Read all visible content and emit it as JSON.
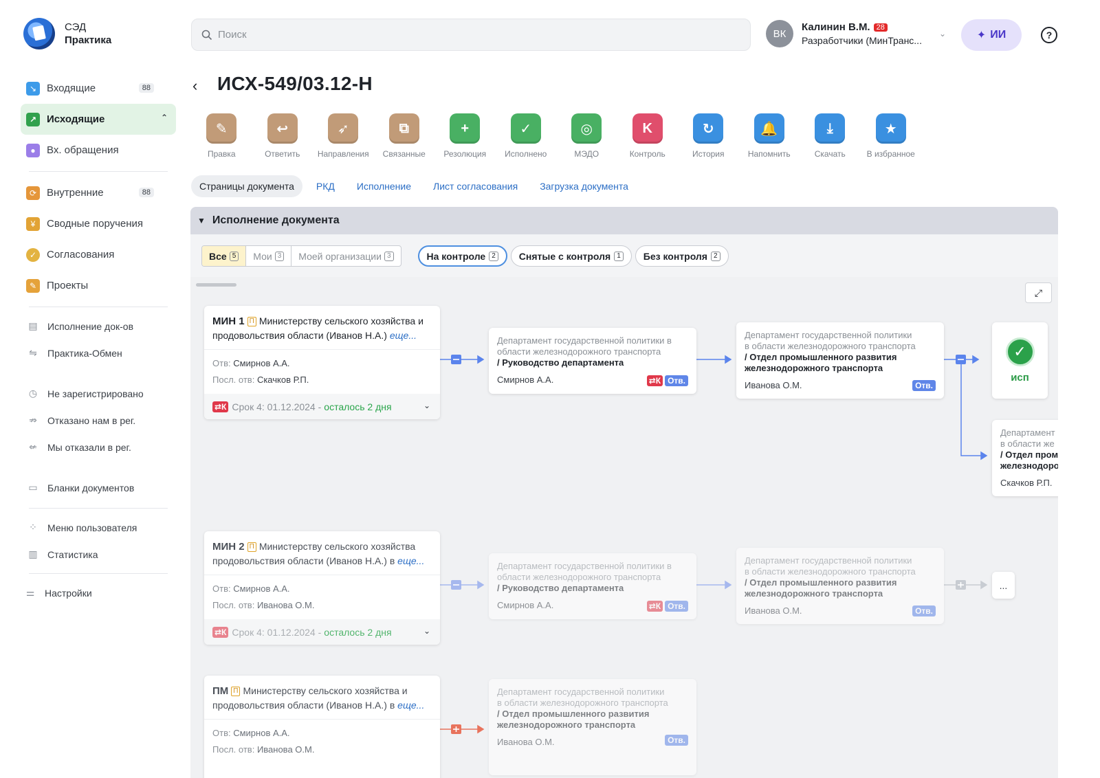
{
  "app": {
    "title_line1": "СЭД",
    "title_line2": "Практика"
  },
  "sidebar": {
    "primary": [
      {
        "label": "Входящие",
        "count": "88",
        "icon": "incoming-arrow-icon",
        "color": "#3d9be9"
      },
      {
        "label": "Исходящие",
        "active": true,
        "icon": "outgoing-arrow-icon",
        "color": "#31a14d"
      },
      {
        "label": "Вх. обращения",
        "icon": "person-icon",
        "color": "#9b7ee8"
      }
    ],
    "secondary": [
      {
        "label": "Внутренние",
        "count": "88",
        "icon": "refresh-icon",
        "color": "#e5963a"
      },
      {
        "label": "Сводные поручения",
        "icon": "merge-icon",
        "color": "#e2a335"
      },
      {
        "label": "Согласования",
        "icon": "check-circle-icon",
        "color": "#e3b341"
      },
      {
        "label": "Проекты",
        "icon": "pencil-icon",
        "color": "#e5a23a"
      }
    ],
    "tertiary": [
      {
        "label": "Исполнение док-ов",
        "icon": "doc-check-icon"
      },
      {
        "label": "Практика-Обмен",
        "icon": "exchange-icon"
      }
    ],
    "registration": [
      {
        "label": "Не зарегистрировано",
        "icon": "timer-icon"
      },
      {
        "label": "Отказано нам в рег.",
        "icon": "reject-in-icon"
      },
      {
        "label": "Мы отказали в рег.",
        "icon": "reject-out-icon"
      }
    ],
    "blanks": [
      {
        "label": "Бланки документов",
        "icon": "document-icon"
      }
    ],
    "user_menu": [
      {
        "label": "Меню пользователя",
        "icon": "grid-dots-icon"
      },
      {
        "label": "Статистика",
        "icon": "bar-chart-icon"
      }
    ],
    "settings": {
      "label": "Настройки",
      "icon": "sliders-icon"
    }
  },
  "search": {
    "placeholder": "Поиск"
  },
  "user": {
    "initials": "ВК",
    "name": "Калинин В.М.",
    "badge": "28",
    "org": "Разработчики (МинТранс..."
  },
  "ai_button": "ИИ",
  "help": "?",
  "document": {
    "title": "ИСХ-549/03.12-Н"
  },
  "toolbar": [
    {
      "label": "Правка",
      "icon": "pencil-icon",
      "color": "#c19b78",
      "glyph": "✎"
    },
    {
      "label": "Ответить",
      "icon": "reply-icon",
      "color": "#c19b78",
      "glyph": "↩"
    },
    {
      "label": "Направления",
      "icon": "compass-icon",
      "color": "#c19b78",
      "glyph": "➶"
    },
    {
      "label": "Связанные",
      "icon": "linked-icon",
      "color": "#c19b78",
      "glyph": "⧉"
    },
    {
      "label": "Резолюция",
      "icon": "plus-icon",
      "color": "#49b063",
      "glyph": "+"
    },
    {
      "label": "Исполнено",
      "icon": "check-icon",
      "color": "#49b063",
      "glyph": "✓"
    },
    {
      "label": "МЭДО",
      "icon": "medo-icon",
      "color": "#49b063",
      "glyph": "◎"
    },
    {
      "label": "Контроль",
      "icon": "control-k-icon",
      "color": "#e04e6c",
      "glyph": "K"
    },
    {
      "label": "История",
      "icon": "history-icon",
      "color": "#3a90e0",
      "glyph": "↻"
    },
    {
      "label": "Напомнить",
      "icon": "bell-icon",
      "color": "#3a90e0",
      "glyph": "🔔"
    },
    {
      "label": "Скачать",
      "icon": "download-icon",
      "color": "#3a90e0",
      "glyph": "⤓"
    },
    {
      "label": "В избранное",
      "icon": "star-icon",
      "color": "#3a90e0",
      "glyph": "★"
    }
  ],
  "tabs": [
    {
      "label": "Страницы документа",
      "active": true
    },
    {
      "label": "РКД"
    },
    {
      "label": "Исполнение"
    },
    {
      "label": "Лист согласования"
    },
    {
      "label": "Загрузка документа"
    }
  ],
  "panel": {
    "title": "Исполнение документа",
    "scope_filters": [
      {
        "label": "Все",
        "count": "5",
        "active": true
      },
      {
        "label": "Мои",
        "count": "3"
      },
      {
        "label": "Моей организации",
        "count": "3"
      }
    ],
    "control_filters": [
      {
        "label": "На контроле",
        "count": "2",
        "active": true
      },
      {
        "label": "Снятые с контроля",
        "count": "1"
      },
      {
        "label": "Без контроля",
        "count": "2"
      }
    ]
  },
  "flow": {
    "rows": [
      {
        "main": {
          "code": "МИН 1",
          "mark": "П",
          "text": "Министерству сельского хозяйства и продовольствия области (Иванов Н.А.)",
          "more": "еще...",
          "otv_label": "Отв:",
          "otv": "Смирнов А.А.",
          "last_label": "Посл. отв:",
          "last": "Скачков Р.П.",
          "k": "⇄К",
          "deadline": "Срок 4: 01.12.2024 -",
          "remaining": "осталось 2 дня"
        },
        "dept1": {
          "line1": "Департамент государственной политики в",
          "line2": "области железнодорожного транспорта",
          "unit": "/ Руководство департамента",
          "person": "Смирнов А.А.",
          "k": "⇄К",
          "otv": "Отв."
        },
        "dept2": {
          "line1": "Департамент государственной политики",
          "line2": "в области железнодорожного транспорта",
          "unit1": "/ Отдел промышленного развития",
          "unit2": "железнодорожного транспорта",
          "person": "Иванова О.М.",
          "otv": "Отв."
        },
        "done": {
          "label": "исп"
        },
        "branch": {
          "line1": "Департамент",
          "line2": "в области же",
          "unit1": "/ Отдел пром",
          "unit2": "железнодоро",
          "person": "Скачков Р.П."
        }
      },
      {
        "main": {
          "code": "МИН 2",
          "mark": "П",
          "text": "Министерству сельского хозяйства продовольствия области (Иванов Н.А.) в",
          "more": "еще...",
          "otv_label": "Отв:",
          "otv": "Смирнов А.А.",
          "last_label": "Посл. отв:",
          "last": "Иванова О.М.",
          "k": "⇄К",
          "deadline": "Срок 4: 01.12.2024 -",
          "remaining": "осталось 2 дня"
        },
        "dept1": {
          "line1": "Департамент государственной политики в",
          "line2": "области железнодорожного транспорта",
          "unit": "/ Руководство департамента",
          "person": "Смирнов А.А.",
          "k": "⇄К",
          "otv": "Отв."
        },
        "dept2": {
          "line1": "Департамент государственной политики",
          "line2": "в области железнодорожного транспорта",
          "unit1": "/ Отдел промышленного развития",
          "unit2": "железнодорожного транспорта",
          "person": "Иванова О.М.",
          "otv": "Отв."
        },
        "dots": "..."
      },
      {
        "main": {
          "code": "ПМ",
          "mark": "П",
          "text": "Министерству сельского хозяйства и продовольствия области (Иванов Н.А.) в",
          "more": "еще...",
          "otv_label": "Отв:",
          "otv": "Смирнов А.А.",
          "last_label": "Посл. отв:",
          "last": "Иванова О.М."
        },
        "dept1": {
          "line1": "Департамент государственной политики",
          "line2": "в области железнодорожного транспорта",
          "unit1": "/ Отдел промышленного развития",
          "unit2": "железнодорожного транспорта",
          "person": "Иванова О.М.",
          "otv": "Отв."
        }
      }
    ]
  }
}
